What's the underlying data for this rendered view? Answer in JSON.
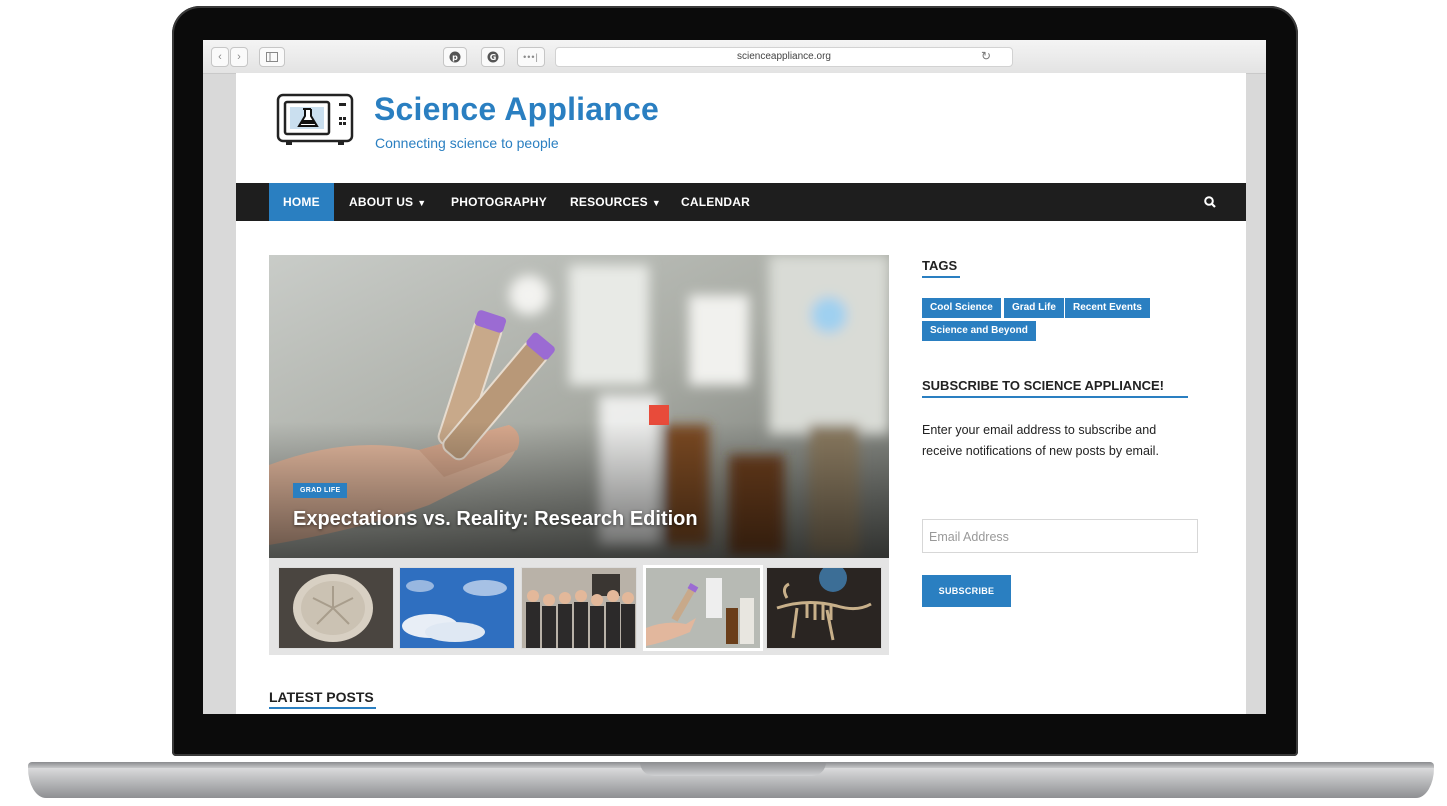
{
  "browser": {
    "url": "scienceappliance.org",
    "back_icon": "chevron-left-icon",
    "forward_icon": "chevron-right-icon",
    "sidebar_icon": "sidebar-toggle-icon",
    "pinterest_icon": "pinterest-icon",
    "extension_icon": "extension-icon",
    "more_icon": "more-dots-icon",
    "reload_icon": "reload-icon"
  },
  "site": {
    "title": "Science Appliance",
    "tagline": "Connecting science to people",
    "accent_color": "#2a7fc1"
  },
  "nav": {
    "items": [
      {
        "label": "HOME",
        "active": true,
        "dropdown": false
      },
      {
        "label": "ABOUT US",
        "active": false,
        "dropdown": true
      },
      {
        "label": "PHOTOGRAPHY",
        "active": false,
        "dropdown": false
      },
      {
        "label": "RESOURCES",
        "active": false,
        "dropdown": true
      },
      {
        "label": "CALENDAR",
        "active": false,
        "dropdown": false
      }
    ],
    "search_icon": "search-icon"
  },
  "featured": {
    "category": "GRAD LIFE",
    "title": "Expectations vs. Reality: Research Edition",
    "thumbnails": [
      "sand-dollar",
      "sky-with-clouds",
      "group-photo",
      "lab-tubes",
      "dinosaur-skeleton"
    ]
  },
  "latest_posts": {
    "heading": "LATEST POSTS"
  },
  "sidebar": {
    "tags_heading": "TAGS",
    "tags": [
      "Cool Science",
      "Grad Life",
      "Recent Events",
      "Science and Beyond"
    ],
    "subscribe_heading": "SUBSCRIBE TO SCIENCE APPLIANCE!",
    "subscribe_text": "Enter your email address to subscribe and receive notifications of new posts by email.",
    "email_placeholder": "Email Address",
    "subscribe_button": "SUBSCRIBE"
  }
}
